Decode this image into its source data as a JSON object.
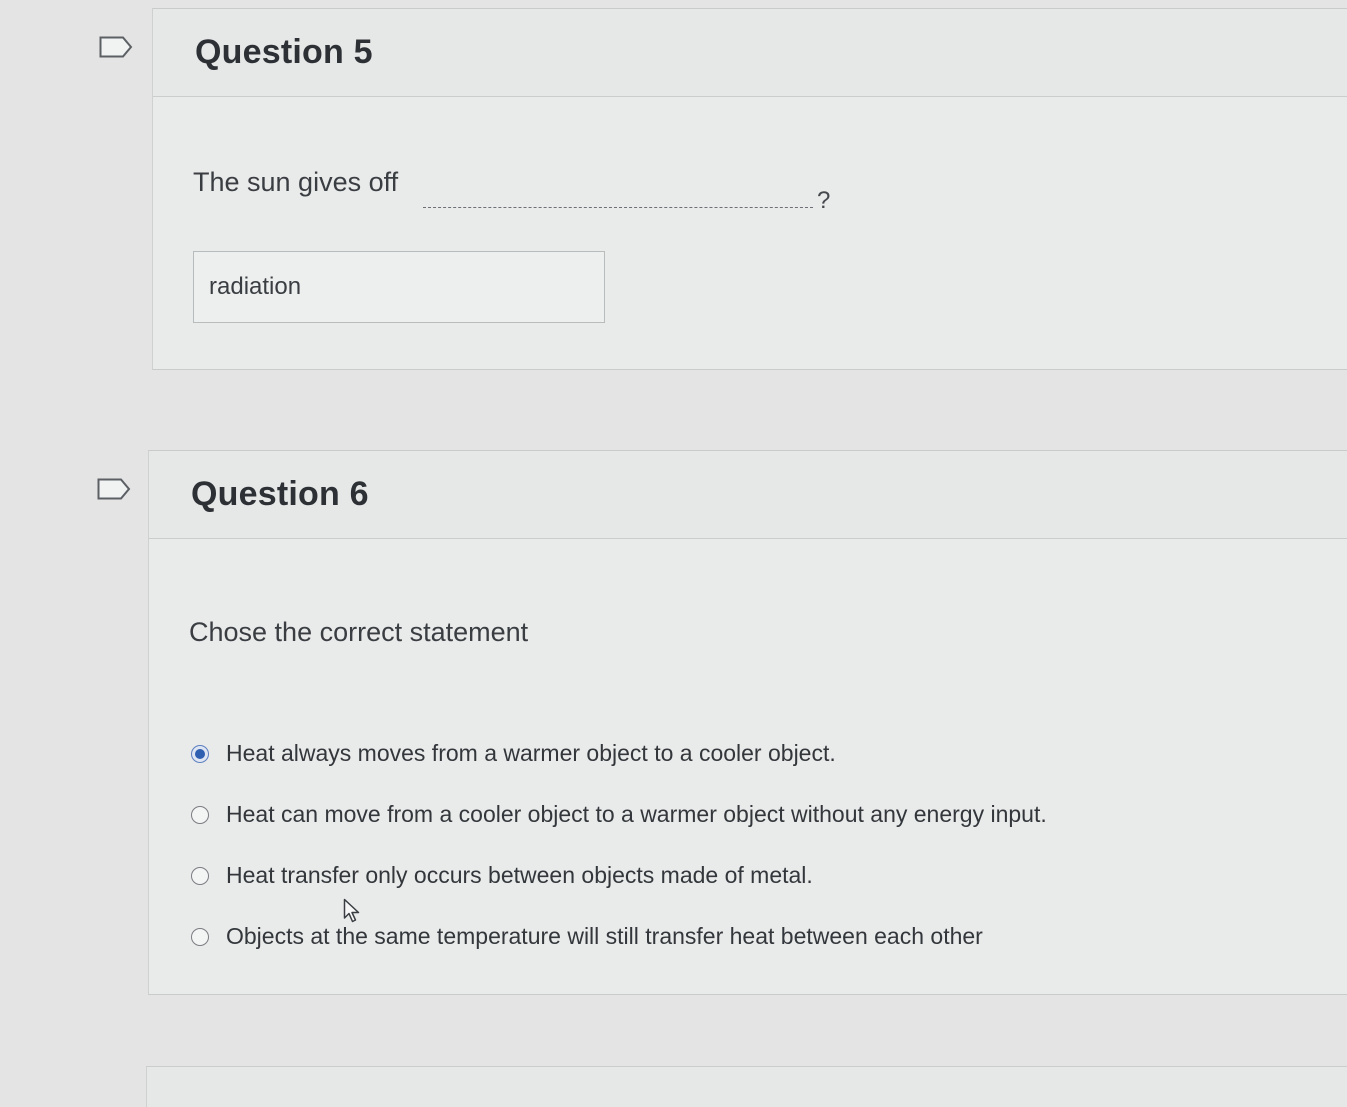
{
  "questions": [
    {
      "title": "Question 5",
      "prompt": "The sun gives off",
      "prompt_suffix": "?",
      "answer_value": "radiation"
    },
    {
      "title": "Question 6",
      "prompt": "Chose the correct statement",
      "options": [
        {
          "label": "Heat always moves from a warmer object to a cooler object.",
          "selected": true
        },
        {
          "label": "Heat can move from a cooler object to a warmer object without any energy input.",
          "selected": false
        },
        {
          "label": "Heat transfer only occurs between objects made of metal.",
          "selected": false
        },
        {
          "label": "Objects at the same temperature will still transfer heat between each other",
          "selected": false
        }
      ]
    }
  ],
  "icons": {
    "flag": "flag-icon",
    "cursor": "mouse-cursor-icon"
  },
  "colors": {
    "selected_radio": "#2f5fb0",
    "background": "#e3e4e3",
    "card": "#e9eaea"
  }
}
